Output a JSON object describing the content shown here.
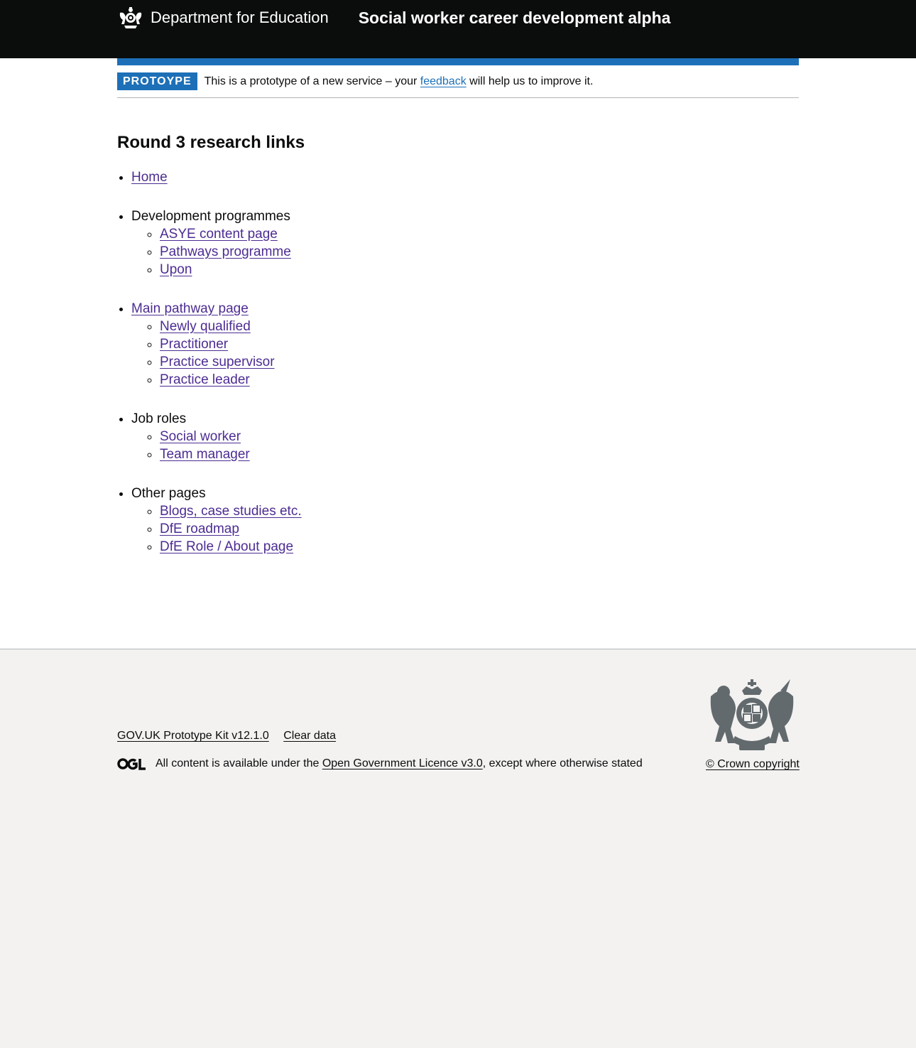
{
  "header": {
    "org_name": "Department for Education",
    "service_name": "Social worker career development alpha"
  },
  "phase_banner": {
    "tag": "PROTOYPE",
    "text_before": "This is a prototype of a new service – your ",
    "link": "feedback",
    "text_after": " will help us to improve it."
  },
  "main": {
    "title": "Round 3 research links",
    "home": "Home",
    "groups": [
      {
        "label": "Development programmes",
        "links": [
          "ASYE content page",
          "Pathways programme",
          "Upon"
        ]
      },
      {
        "label": "Main pathway page",
        "links": [
          "Newly qualified",
          "Practitioner",
          "Practice supervisor",
          "Practice leader"
        ]
      },
      {
        "label": "Job roles",
        "links": [
          "Social worker",
          "Team manager"
        ]
      },
      {
        "label": "Other pages",
        "links": [
          "Blogs, case studies etc.",
          "DfE roadmap",
          "DfE Role / About page"
        ]
      }
    ]
  },
  "footer": {
    "kit_link": "GOV.UK Prototype Kit v12.1.0",
    "clear_data": "Clear data",
    "licence_before": "All content is available under the ",
    "licence_link": "Open Government Licence v3.0",
    "licence_after": ", except where otherwise stated",
    "copyright": "© Crown copyright"
  }
}
